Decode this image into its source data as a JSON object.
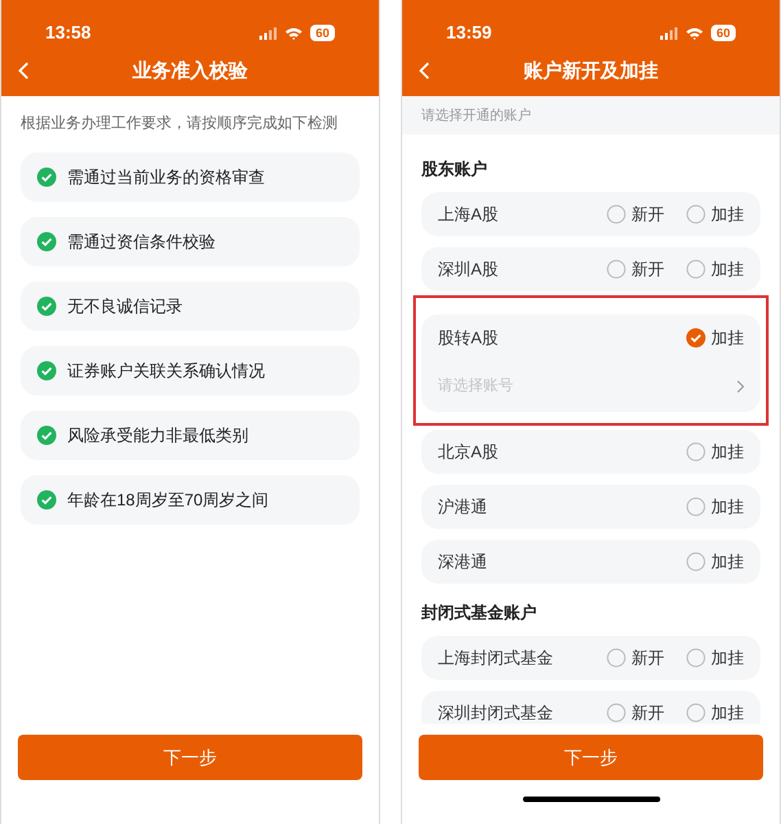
{
  "screens": [
    {
      "kind": "checklist",
      "status_bar": {
        "time": "13:58",
        "battery": "60"
      },
      "title": "业务准入校验",
      "intro": "根据业务办理工作要求，请按顺序完成如下检测",
      "checks": [
        {
          "label": "需通过当前业务的资格审查",
          "passed": true
        },
        {
          "label": "需通过资信条件校验",
          "passed": true
        },
        {
          "label": "无不良诚信记录",
          "passed": true
        },
        {
          "label": "证券账户关联关系确认情况",
          "passed": true
        },
        {
          "label": "风险承受能力非最低类别",
          "passed": true
        },
        {
          "label": "年龄在18周岁至70周岁之间",
          "passed": true
        }
      ],
      "button": "下一步",
      "home_indicator": false
    },
    {
      "kind": "account_form",
      "status_bar": {
        "time": "13:59",
        "battery": "60"
      },
      "title": "账户新开及加挂",
      "hint": "请选择开通的账户",
      "sections": [
        {
          "title": "股东账户",
          "rows": [
            {
              "name": "上海A股",
              "highlighted": false,
              "options": [
                {
                  "label": "新开",
                  "selected": false
                },
                {
                  "label": "加挂",
                  "selected": false
                }
              ]
            },
            {
              "name": "深圳A股",
              "highlighted": false,
              "options": [
                {
                  "label": "新开",
                  "selected": false
                },
                {
                  "label": "加挂",
                  "selected": false
                }
              ]
            },
            {
              "name": "股转A股",
              "highlighted": true,
              "options": [
                {
                  "label": "加挂",
                  "selected": true
                }
              ],
              "account_picker": {
                "placeholder": "请选择账号"
              }
            },
            {
              "name": "北京A股",
              "highlighted": false,
              "options": [
                {
                  "label": "加挂",
                  "selected": false
                }
              ]
            },
            {
              "name": "沪港通",
              "highlighted": false,
              "options": [
                {
                  "label": "加挂",
                  "selected": false
                }
              ]
            },
            {
              "name": "深港通",
              "highlighted": false,
              "options": [
                {
                  "label": "加挂",
                  "selected": false
                }
              ]
            }
          ]
        },
        {
          "title": "封闭式基金账户",
          "rows": [
            {
              "name": "上海封闭式基金",
              "highlighted": false,
              "options": [
                {
                  "label": "新开",
                  "selected": false
                },
                {
                  "label": "加挂",
                  "selected": false
                }
              ]
            },
            {
              "name": "深圳封闭式基金",
              "highlighted": false,
              "options": [
                {
                  "label": "新开",
                  "selected": false
                },
                {
                  "label": "加挂",
                  "selected": false
                }
              ]
            }
          ]
        }
      ],
      "button": "下一步",
      "home_indicator": true
    }
  ]
}
